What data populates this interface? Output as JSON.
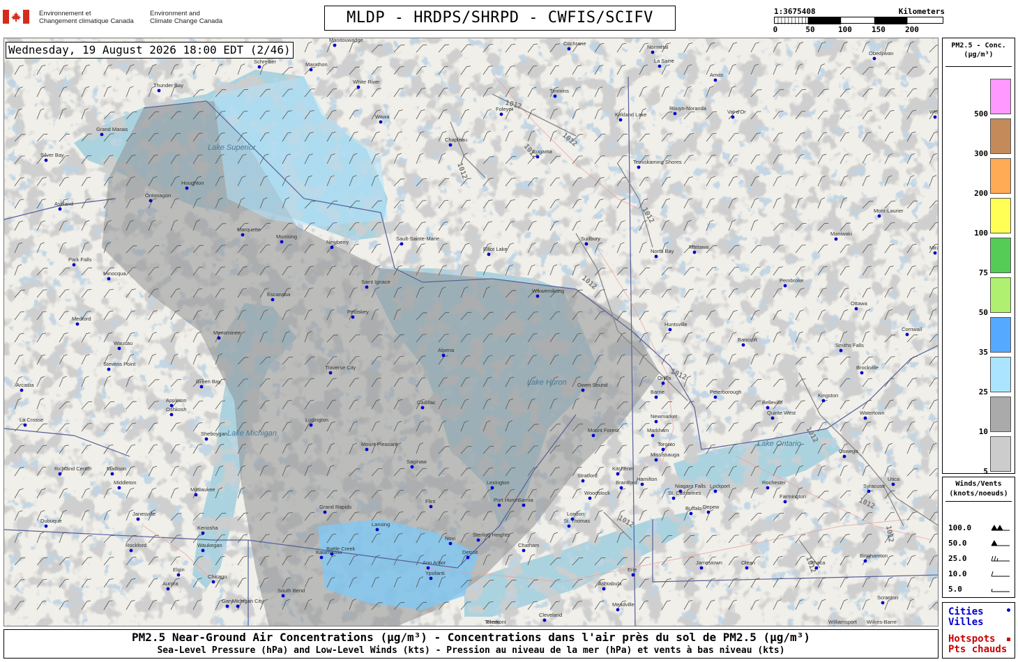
{
  "header": {
    "gov_fr": "Environnement et",
    "gov_fr2": "Changement climatique Canada",
    "gov_en": "Environment and",
    "gov_en2": "Climate Change Canada",
    "title": "MLDP - HRDPS/SHRPD - CWFIS/SCIFV"
  },
  "scale": {
    "ratio": "1:3675408",
    "unit": "Kilometers",
    "ticks": [
      "0",
      "50",
      "100",
      "150",
      "200"
    ]
  },
  "map": {
    "datetime": "Wednesday, 19 August 2026 18:00 EDT (2/46)",
    "isobar_label": "1012",
    "cities": [
      {
        "name": "Thunder Bay"
      },
      {
        "name": "Grand Marais"
      },
      {
        "name": "Silver Bay"
      },
      {
        "name": "Houghton"
      },
      {
        "name": "Ashland"
      },
      {
        "name": "Ontonagon"
      },
      {
        "name": "Marquette"
      },
      {
        "name": "Munising"
      },
      {
        "name": "Newberry"
      },
      {
        "name": "Sault-Sainte-Marie"
      },
      {
        "name": "Elliot Lake"
      },
      {
        "name": "Saint Ignace"
      },
      {
        "name": "Escanaba"
      },
      {
        "name": "Menominee"
      },
      {
        "name": "Wausau"
      },
      {
        "name": "Stevens Point"
      },
      {
        "name": "Green Bay"
      },
      {
        "name": "Appleton"
      },
      {
        "name": "Oshkosh"
      },
      {
        "name": "Sheboygan"
      },
      {
        "name": "Milwaukee"
      },
      {
        "name": "Madison"
      },
      {
        "name": "Janesville"
      },
      {
        "name": "Rockford"
      },
      {
        "name": "Chicago"
      },
      {
        "name": "Waukegan"
      },
      {
        "name": "Kenosha"
      },
      {
        "name": "Gary"
      },
      {
        "name": "Michigan City"
      },
      {
        "name": "South Bend"
      },
      {
        "name": "Elgin"
      },
      {
        "name": "Aurora"
      },
      {
        "name": "Dubuque"
      },
      {
        "name": "La Crosse"
      },
      {
        "name": "Richland Center"
      },
      {
        "name": "Middleton"
      },
      {
        "name": "Park Falls"
      },
      {
        "name": "Minocqua"
      },
      {
        "name": "Medford"
      },
      {
        "name": "Arcadia"
      },
      {
        "name": "Traverse City"
      },
      {
        "name": "Petoskey"
      },
      {
        "name": "Alpena"
      },
      {
        "name": "Cadillac"
      },
      {
        "name": "Ludington"
      },
      {
        "name": "Mount Pleasant"
      },
      {
        "name": "Saginaw"
      },
      {
        "name": "Flint"
      },
      {
        "name": "Grand Rapids"
      },
      {
        "name": "Lansing"
      },
      {
        "name": "Battle Creek"
      },
      {
        "name": "Kalamazoo"
      },
      {
        "name": "Ann Arbor"
      },
      {
        "name": "Ypsilanti"
      },
      {
        "name": "Detroit"
      },
      {
        "name": "Novi"
      },
      {
        "name": "Sterling Heights"
      },
      {
        "name": "Port Huron"
      },
      {
        "name": "Sarnia"
      },
      {
        "name": "Lexington"
      },
      {
        "name": "Chatham"
      },
      {
        "name": "London"
      },
      {
        "name": "St. Thomas"
      },
      {
        "name": "Woodstock"
      },
      {
        "name": "Stratford"
      },
      {
        "name": "Kitchener"
      },
      {
        "name": "Brantford"
      },
      {
        "name": "Hamilton"
      },
      {
        "name": "Mississauga"
      },
      {
        "name": "Toronto"
      },
      {
        "name": "Markham"
      },
      {
        "name": "Newmarket"
      },
      {
        "name": "Barrie"
      },
      {
        "name": "Orillia"
      },
      {
        "name": "Owen Sound"
      },
      {
        "name": "Mount Forest"
      },
      {
        "name": "Wikwemikong"
      },
      {
        "name": "Sudbury"
      },
      {
        "name": "North Bay"
      },
      {
        "name": "Huntsville"
      },
      {
        "name": "Bancroft"
      },
      {
        "name": "Peterborough"
      },
      {
        "name": "Belleville"
      },
      {
        "name": "Quinte West"
      },
      {
        "name": "Kingston"
      },
      {
        "name": "Watertown"
      },
      {
        "name": "Oswego"
      },
      {
        "name": "Syracuse"
      },
      {
        "name": "Utica"
      },
      {
        "name": "Rochester"
      },
      {
        "name": "Farmington"
      },
      {
        "name": "Buffalo"
      },
      {
        "name": "Niagara Falls"
      },
      {
        "name": "St. Catharines"
      },
      {
        "name": "Lockport"
      },
      {
        "name": "Depew"
      },
      {
        "name": "Erie"
      },
      {
        "name": "Jamestown"
      },
      {
        "name": "Olean"
      },
      {
        "name": "Ithaca"
      },
      {
        "name": "Binghamton"
      },
      {
        "name": "Scranton"
      },
      {
        "name": "Wilkes-Barre"
      },
      {
        "name": "Williamsport"
      },
      {
        "name": "Meadville"
      },
      {
        "name": "Ashtabula"
      },
      {
        "name": "Cleveland"
      },
      {
        "name": "Toledo"
      },
      {
        "name": "Fremont"
      },
      {
        "name": "Mattawa"
      },
      {
        "name": "Pembroke"
      },
      {
        "name": "Ottawa"
      },
      {
        "name": "Cornwall"
      },
      {
        "name": "Smiths Falls"
      },
      {
        "name": "Brockville"
      },
      {
        "name": "Maniwaki"
      },
      {
        "name": "Mont-Laurier"
      },
      {
        "name": "Mirabel"
      },
      {
        "name": "Temiskaming Shores"
      },
      {
        "name": "Kirkland Lake"
      },
      {
        "name": "Rouyn-Noranda"
      },
      {
        "name": "Val-d'Or"
      },
      {
        "name": "Amos"
      },
      {
        "name": "La Sarre"
      },
      {
        "name": "Normétal"
      },
      {
        "name": "Cochrane"
      },
      {
        "name": "Timmins"
      },
      {
        "name": "Foleyet"
      },
      {
        "name": "Chapleau"
      },
      {
        "name": "Gogama"
      },
      {
        "name": "Wawa"
      },
      {
        "name": "White River"
      },
      {
        "name": "Marathon"
      },
      {
        "name": "Schreiber"
      },
      {
        "name": "Manitouwadge"
      },
      {
        "name": "Obedjiwan"
      },
      {
        "name": "Wemotaci"
      },
      {
        "name": "Lake Superior"
      },
      {
        "name": "Lake Michigan"
      },
      {
        "name": "Lake Ontario"
      },
      {
        "name": "Lake Huron"
      }
    ]
  },
  "pm_legend": {
    "title1": "PM2.5 - Conc.",
    "title2": "(μg/m³)",
    "levels": [
      {
        "label": "500",
        "color": "#ff99ff"
      },
      {
        "label": "300",
        "color": "#c48a5a"
      },
      {
        "label": "200",
        "color": "#ffaa55"
      },
      {
        "label": "100",
        "color": "#ffff55"
      },
      {
        "label": "75",
        "color": "#55cc55"
      },
      {
        "label": "50",
        "color": "#b0f070"
      },
      {
        "label": "35",
        "color": "#55aaff"
      },
      {
        "label": "25",
        "color": "#aae4ff"
      },
      {
        "label": "10",
        "color": "#aaaaaa"
      },
      {
        "label": "5",
        "color": "#cccccc"
      }
    ]
  },
  "wind_legend": {
    "title1": "Winds/Vents",
    "title2": "(knots/noeuds)",
    "rows": [
      "100.0",
      "50.0",
      "25.0",
      "10.0",
      "5.0"
    ]
  },
  "key_legend": {
    "cities_en": "Cities",
    "cities_fr": "Villes",
    "hotspots_en": "Hotspots",
    "hotspots_fr": "Pts chauds",
    "city_color": "#0000cc",
    "hotspot_color": "#cc0000"
  },
  "footer": {
    "line1": "PM2.5 Near-Ground Air Concentrations (μg/m³) - Concentrations dans l'air près du sol de PM2.5 (μg/m³)",
    "line2": "Sea-Level Pressure (hPa) and Low-Level Winds (kts) - Pression au niveau de la mer (hPa) et vents à bas niveau (kts)"
  }
}
